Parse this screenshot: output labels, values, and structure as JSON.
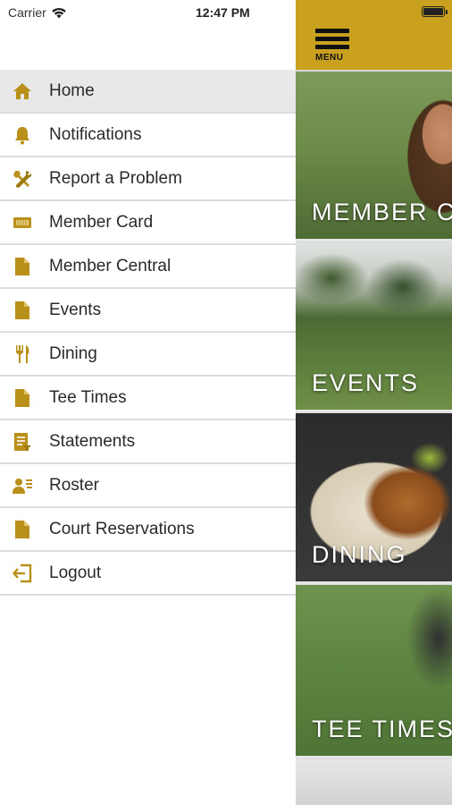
{
  "status_bar": {
    "carrier": "Carrier",
    "time": "12:47 PM",
    "battery_level": 1.0
  },
  "drawer": {
    "items": [
      {
        "label": "Home",
        "icon": "home-icon",
        "active": true
      },
      {
        "label": "Notifications",
        "icon": "bell-icon"
      },
      {
        "label": "Report a Problem",
        "icon": "tools-icon"
      },
      {
        "label": "Member Card",
        "icon": "card-icon"
      },
      {
        "label": "Member Central",
        "icon": "document-icon"
      },
      {
        "label": "Events",
        "icon": "document-icon"
      },
      {
        "label": "Dining",
        "icon": "utensils-icon"
      },
      {
        "label": "Tee Times",
        "icon": "document-icon"
      },
      {
        "label": "Statements",
        "icon": "statement-icon"
      },
      {
        "label": "Roster",
        "icon": "roster-icon"
      },
      {
        "label": "Court Reservations",
        "icon": "document-icon"
      },
      {
        "label": "Logout",
        "icon": "logout-icon"
      }
    ]
  },
  "header": {
    "menu_label": "MENU"
  },
  "tiles": [
    {
      "label": "MEMBER CENTRAL"
    },
    {
      "label": "EVENTS"
    },
    {
      "label": "DINING"
    },
    {
      "label": "TEE TIMES"
    }
  ],
  "colors": {
    "accent": "#c9a11e",
    "icon": "#b8901a",
    "active_row": "#e8e8e8",
    "divider": "#dddddd"
  }
}
